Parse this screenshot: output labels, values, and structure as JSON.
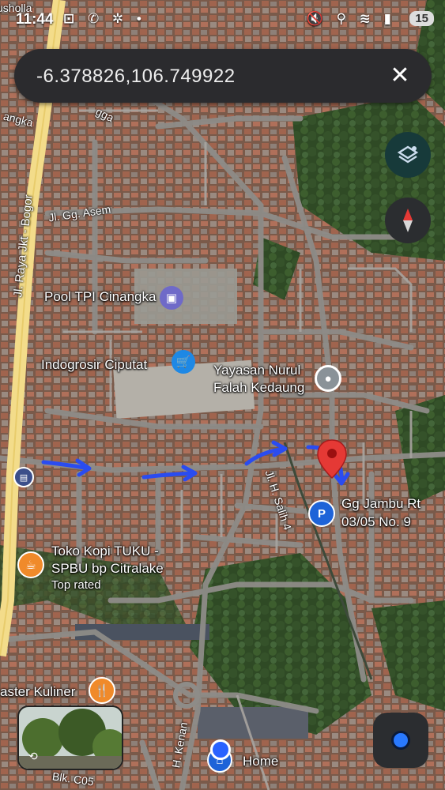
{
  "status_bar": {
    "time": "11:44",
    "battery": "15"
  },
  "search": {
    "coordinates": "-6.378826,106.749922",
    "close_label": "✕"
  },
  "map": {
    "roads": {
      "main": "Jl. Raya Jkt - Bogor",
      "asem": "Jl. Gg. Asem",
      "salih": "Jl. H. Salih 4",
      "angka": "angka",
      "gga": "gga",
      "musholla": "usholla",
      "kenan": "H. Kenan",
      "blk": "Blk. C05"
    },
    "places": {
      "pool": "Pool TPI Cinangka",
      "indogrosir": "Indogrosir Ciputat",
      "yayasan_line1": "Yayasan Nurul",
      "yayasan_line2": "Falah Kedaung",
      "gg_jambu_line1": "Gg Jambu Rt",
      "gg_jambu_line2": "03/05 No. 9",
      "toko_line1": "Toko Kopi TUKU -",
      "toko_line2": "SPBU bp Citralake",
      "toko_badge": "Top rated",
      "kuliner": "aster Kuliner",
      "home": "Home"
    }
  },
  "colors": {
    "accent_blue": "#2962ff",
    "pin_red": "#e53935",
    "road_yellow": "#f3dc8a"
  }
}
